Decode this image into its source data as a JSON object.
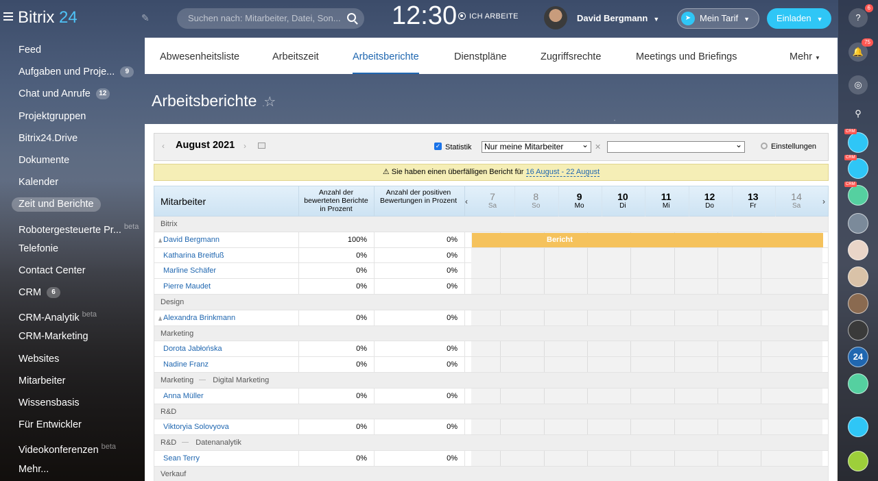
{
  "header": {
    "logo_text": "Bitrix",
    "logo_num": "24",
    "search_placeholder": "Suchen nach: Mitarbeiter, Datei, Son...",
    "clock": "12:30",
    "work_status": "ICH ARBEITE",
    "user_name": "David Bergmann",
    "tarif_label": "Mein Tarif",
    "invite_label": "Einladen"
  },
  "sidebar": {
    "items": [
      {
        "label": "Feed",
        "badge": "",
        "beta": ""
      },
      {
        "label": "Aufgaben und Proje...",
        "badge": "9",
        "beta": ""
      },
      {
        "label": "Chat und Anrufe",
        "badge": "12",
        "beta": ""
      },
      {
        "label": "Projektgruppen",
        "badge": "",
        "beta": ""
      },
      {
        "label": "Bitrix24.Drive",
        "badge": "",
        "beta": ""
      },
      {
        "label": "Dokumente",
        "badge": "",
        "beta": ""
      },
      {
        "label": "Kalender",
        "badge": "",
        "beta": ""
      },
      {
        "label": "Zeit und Berichte",
        "badge": "",
        "beta": ""
      },
      {
        "label": "Robotergesteuerte Pr...",
        "badge": "",
        "beta": "beta"
      },
      {
        "label": "Telefonie",
        "badge": "",
        "beta": ""
      },
      {
        "label": "Contact Center",
        "badge": "",
        "beta": ""
      },
      {
        "label": "CRM",
        "badge": "6",
        "beta": ""
      },
      {
        "label": "CRM-Analytik",
        "badge": "",
        "beta": "beta"
      },
      {
        "label": "CRM-Marketing",
        "badge": "",
        "beta": ""
      },
      {
        "label": "Websites",
        "badge": "",
        "beta": ""
      },
      {
        "label": "Mitarbeiter",
        "badge": "",
        "beta": ""
      },
      {
        "label": "Wissensbasis",
        "badge": "",
        "beta": ""
      },
      {
        "label": "Für Entwickler",
        "badge": "",
        "beta": ""
      },
      {
        "label": "Videokonferenzen",
        "badge": "",
        "beta": "beta"
      },
      {
        "label": "Mehr...",
        "badge": "",
        "beta": ""
      }
    ]
  },
  "rightbar": {
    "help_badge": "6",
    "notif_badge": "75",
    "crm_tag": "CRM",
    "bitrix_label": "24"
  },
  "tabs": [
    {
      "label": "Abwesenheitsliste"
    },
    {
      "label": "Arbeitszeit"
    },
    {
      "label": "Arbeitsberichte"
    },
    {
      "label": "Dienstpläne"
    },
    {
      "label": "Zugriffsrechte"
    },
    {
      "label": "Meetings und Briefings"
    },
    {
      "label": "Mehr"
    }
  ],
  "page_title": "Arbeitsberichte",
  "toolbar": {
    "month": "August 2021",
    "statistik_label": "Statistik",
    "filter_value": "Nur meine Mitarbeiter",
    "filter2_value": "",
    "settings_label": "Einstellungen"
  },
  "warning": {
    "text": "Sie haben einen überfälligen Bericht für",
    "link": "16 August - 22 August"
  },
  "table": {
    "col_employee": "Mitarbeiter",
    "col_rated": "Anzahl der bewerteten Berichte in Prozent",
    "col_positive": "Anzahl der positiven Bewertungen in Prozent",
    "days": [
      {
        "d": "7",
        "w": "Sa",
        "weekend": true
      },
      {
        "d": "8",
        "w": "So",
        "weekend": true
      },
      {
        "d": "9",
        "w": "Mo",
        "weekend": false
      },
      {
        "d": "10",
        "w": "Di",
        "weekend": false
      },
      {
        "d": "11",
        "w": "Mi",
        "weekend": false
      },
      {
        "d": "12",
        "w": "Do",
        "weekend": false
      },
      {
        "d": "13",
        "w": "Fr",
        "weekend": false
      },
      {
        "d": "14",
        "w": "Sa",
        "weekend": true
      }
    ],
    "report_label": "Bericht",
    "rows": [
      {
        "type": "group",
        "name": "Bitrix",
        "sub": ""
      },
      {
        "type": "emp",
        "name": "David Bergmann",
        "head": true,
        "rated": "100%",
        "positive": "0%",
        "report": true
      },
      {
        "type": "emp",
        "name": "Katharina Breitfuß",
        "head": false,
        "rated": "0%",
        "positive": "0%",
        "report": false
      },
      {
        "type": "emp",
        "name": "Marline Schäfer",
        "head": false,
        "rated": "0%",
        "positive": "0%",
        "report": false
      },
      {
        "type": "emp",
        "name": "Pierre Maudet",
        "head": false,
        "rated": "0%",
        "positive": "0%",
        "report": false
      },
      {
        "type": "group",
        "name": "Design",
        "sub": ""
      },
      {
        "type": "emp",
        "name": "Alexandra Brinkmann",
        "head": true,
        "rated": "0%",
        "positive": "0%",
        "report": false
      },
      {
        "type": "group",
        "name": "Marketing",
        "sub": ""
      },
      {
        "type": "emp",
        "name": "Dorota Jabłońska",
        "head": false,
        "rated": "0%",
        "positive": "0%",
        "report": false
      },
      {
        "type": "emp",
        "name": "Nadine Franz",
        "head": false,
        "rated": "0%",
        "positive": "0%",
        "report": false
      },
      {
        "type": "group",
        "name": "Marketing",
        "sub": "Digital Marketing"
      },
      {
        "type": "emp",
        "name": "Anna Müller",
        "head": false,
        "rated": "0%",
        "positive": "0%",
        "report": false
      },
      {
        "type": "group",
        "name": "R&D",
        "sub": ""
      },
      {
        "type": "emp",
        "name": "Viktoryia Solovyova",
        "head": false,
        "rated": "0%",
        "positive": "0%",
        "report": false
      },
      {
        "type": "group",
        "name": "R&D",
        "sub": "Datenanalytik"
      },
      {
        "type": "emp",
        "name": "Sean Terry",
        "head": false,
        "rated": "0%",
        "positive": "0%",
        "report": false
      },
      {
        "type": "group",
        "name": "Verkauf",
        "sub": ""
      }
    ]
  }
}
